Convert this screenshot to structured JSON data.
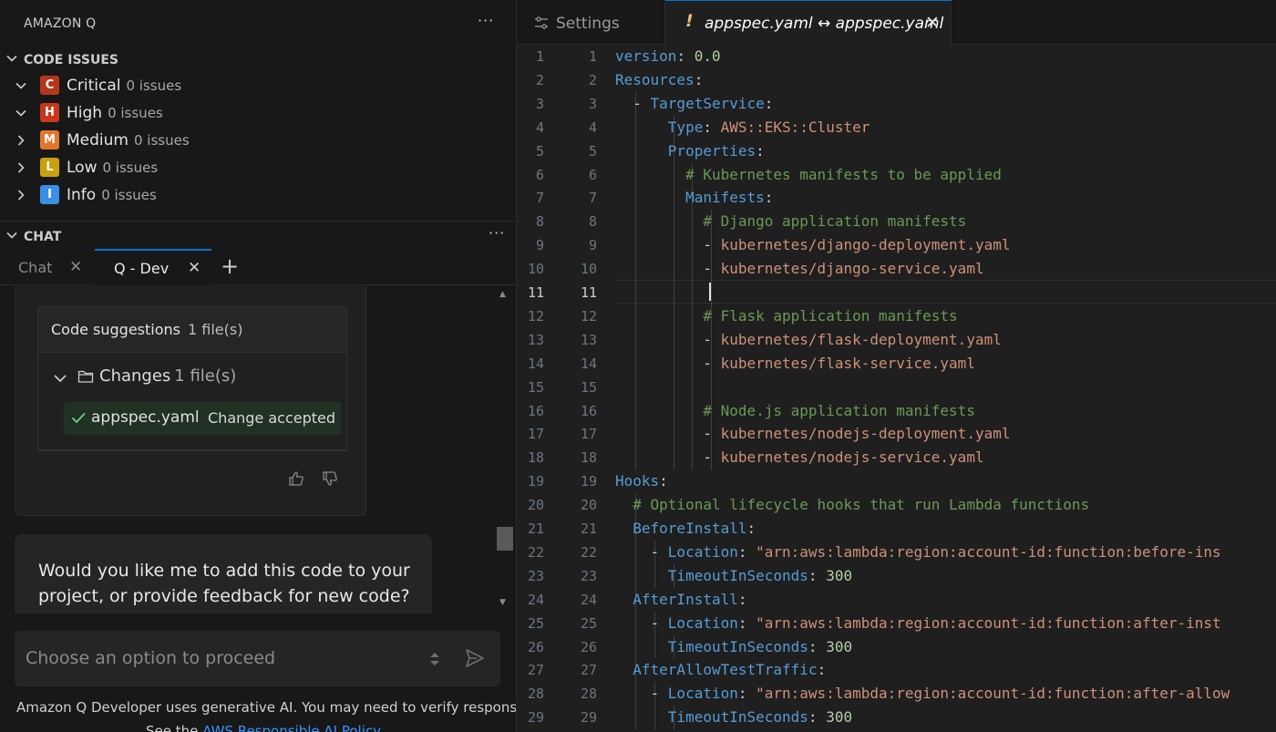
{
  "left_panel": {
    "title": "AMAZON Q",
    "more": "···",
    "code_issues": {
      "label": "CODE ISSUES",
      "items": [
        {
          "letter": "C",
          "name": "Critical",
          "count": "0 issues",
          "color": "#b5361b",
          "expanded": true
        },
        {
          "letter": "H",
          "name": "High",
          "count": "0 issues",
          "color": "#c9371c",
          "expanded": true
        },
        {
          "letter": "M",
          "name": "Medium",
          "count": "0 issues",
          "color": "#e2772c",
          "expanded": false
        },
        {
          "letter": "L",
          "name": "Low",
          "count": "0 issues",
          "color": "#c6a10c",
          "expanded": false
        },
        {
          "letter": "I",
          "name": "Info",
          "count": "0 issues",
          "color": "#3a8ee6",
          "expanded": false
        }
      ]
    },
    "chat": {
      "label": "CHAT",
      "tabs": [
        {
          "label": "Chat",
          "close": "✕"
        },
        {
          "label": "Q - Dev",
          "close": "✕"
        }
      ],
      "add_tab": "+",
      "suggestions": {
        "title": "Code suggestions",
        "count": "1 file(s)",
        "changes_label": "Changes",
        "changes_count": "1 file(s)",
        "file_name": "appspec.yaml",
        "file_status": "Change accepted"
      },
      "message": "Would you like me to add this code to your project, or provide feedback for new code?",
      "input_placeholder": "Choose an option to proceed",
      "disclaimer": "Amazon Q Developer uses generative AI. You may need to verify responses.",
      "policy_prefix": "See the",
      "policy_link": "AWS Responsible AI Policy."
    }
  },
  "editor": {
    "tabs": [
      {
        "label": "Settings",
        "icon": "settings-icon"
      },
      {
        "label": "appspec.yaml ↔ appspec.yaml",
        "icon": "warning-icon",
        "bang": "!",
        "close": "✕",
        "active": true
      }
    ],
    "active_line": 11,
    "lines": [
      [
        {
          "t": "version",
          "c": "key"
        },
        {
          "t": ": ",
          "c": "pun"
        },
        {
          "t": "0.0",
          "c": "num"
        }
      ],
      [
        {
          "t": "Resources",
          "c": "key"
        },
        {
          "t": ":",
          "c": "pun"
        }
      ],
      [
        {
          "t": "  - ",
          "c": "pun"
        },
        {
          "t": "TargetService",
          "c": "key"
        },
        {
          "t": ":",
          "c": "pun"
        }
      ],
      [
        {
          "t": "      ",
          "c": "pun"
        },
        {
          "t": "Type",
          "c": "key"
        },
        {
          "t": ": ",
          "c": "pun"
        },
        {
          "t": "AWS::EKS::Cluster",
          "c": "val"
        }
      ],
      [
        {
          "t": "      ",
          "c": "pun"
        },
        {
          "t": "Properties",
          "c": "key"
        },
        {
          "t": ":",
          "c": "pun"
        }
      ],
      [
        {
          "t": "        ",
          "c": "pun"
        },
        {
          "t": "# Kubernetes manifests to be applied",
          "c": "cmt"
        }
      ],
      [
        {
          "t": "        ",
          "c": "pun"
        },
        {
          "t": "Manifests",
          "c": "key"
        },
        {
          "t": ":",
          "c": "pun"
        }
      ],
      [
        {
          "t": "          ",
          "c": "pun"
        },
        {
          "t": "# Django application manifests",
          "c": "cmt"
        }
      ],
      [
        {
          "t": "          - ",
          "c": "pun"
        },
        {
          "t": "kubernetes/django-deployment.yaml",
          "c": "val"
        }
      ],
      [
        {
          "t": "          - ",
          "c": "pun"
        },
        {
          "t": "kubernetes/django-service.yaml",
          "c": "val"
        }
      ],
      [],
      [
        {
          "t": "          ",
          "c": "pun"
        },
        {
          "t": "# Flask application manifests",
          "c": "cmt"
        }
      ],
      [
        {
          "t": "          - ",
          "c": "pun"
        },
        {
          "t": "kubernetes/flask-deployment.yaml",
          "c": "val"
        }
      ],
      [
        {
          "t": "          - ",
          "c": "pun"
        },
        {
          "t": "kubernetes/flask-service.yaml",
          "c": "val"
        }
      ],
      [],
      [
        {
          "t": "          ",
          "c": "pun"
        },
        {
          "t": "# Node.js application manifests",
          "c": "cmt"
        }
      ],
      [
        {
          "t": "          - ",
          "c": "pun"
        },
        {
          "t": "kubernetes/nodejs-deployment.yaml",
          "c": "val"
        }
      ],
      [
        {
          "t": "          - ",
          "c": "pun"
        },
        {
          "t": "kubernetes/nodejs-service.yaml",
          "c": "val"
        }
      ],
      [
        {
          "t": "Hooks",
          "c": "key"
        },
        {
          "t": ":",
          "c": "pun"
        }
      ],
      [
        {
          "t": "  ",
          "c": "pun"
        },
        {
          "t": "# Optional lifecycle hooks that run Lambda functions",
          "c": "cmt"
        }
      ],
      [
        {
          "t": "  ",
          "c": "pun"
        },
        {
          "t": "BeforeInstall",
          "c": "key"
        },
        {
          "t": ":",
          "c": "pun"
        }
      ],
      [
        {
          "t": "    - ",
          "c": "pun"
        },
        {
          "t": "Location",
          "c": "key"
        },
        {
          "t": ": ",
          "c": "pun"
        },
        {
          "t": "\"arn:aws:lambda:region:account-id:function:before-ins",
          "c": "val"
        }
      ],
      [
        {
          "t": "      ",
          "c": "pun"
        },
        {
          "t": "TimeoutInSeconds",
          "c": "key"
        },
        {
          "t": ": ",
          "c": "pun"
        },
        {
          "t": "300",
          "c": "num"
        }
      ],
      [
        {
          "t": "  ",
          "c": "pun"
        },
        {
          "t": "AfterInstall",
          "c": "key"
        },
        {
          "t": ":",
          "c": "pun"
        }
      ],
      [
        {
          "t": "    - ",
          "c": "pun"
        },
        {
          "t": "Location",
          "c": "key"
        },
        {
          "t": ": ",
          "c": "pun"
        },
        {
          "t": "\"arn:aws:lambda:region:account-id:function:after-inst",
          "c": "val"
        }
      ],
      [
        {
          "t": "      ",
          "c": "pun"
        },
        {
          "t": "TimeoutInSeconds",
          "c": "key"
        },
        {
          "t": ": ",
          "c": "pun"
        },
        {
          "t": "300",
          "c": "num"
        }
      ],
      [
        {
          "t": "  ",
          "c": "pun"
        },
        {
          "t": "AfterAllowTestTraffic",
          "c": "key"
        },
        {
          "t": ":",
          "c": "pun"
        }
      ],
      [
        {
          "t": "    - ",
          "c": "pun"
        },
        {
          "t": "Location",
          "c": "key"
        },
        {
          "t": ": ",
          "c": "pun"
        },
        {
          "t": "\"arn:aws:lambda:region:account-id:function:after-allow",
          "c": "val"
        }
      ],
      [
        {
          "t": "      ",
          "c": "pun"
        },
        {
          "t": "TimeoutInSeconds",
          "c": "key"
        },
        {
          "t": ": ",
          "c": "pun"
        },
        {
          "t": "300",
          "c": "num"
        }
      ]
    ]
  }
}
